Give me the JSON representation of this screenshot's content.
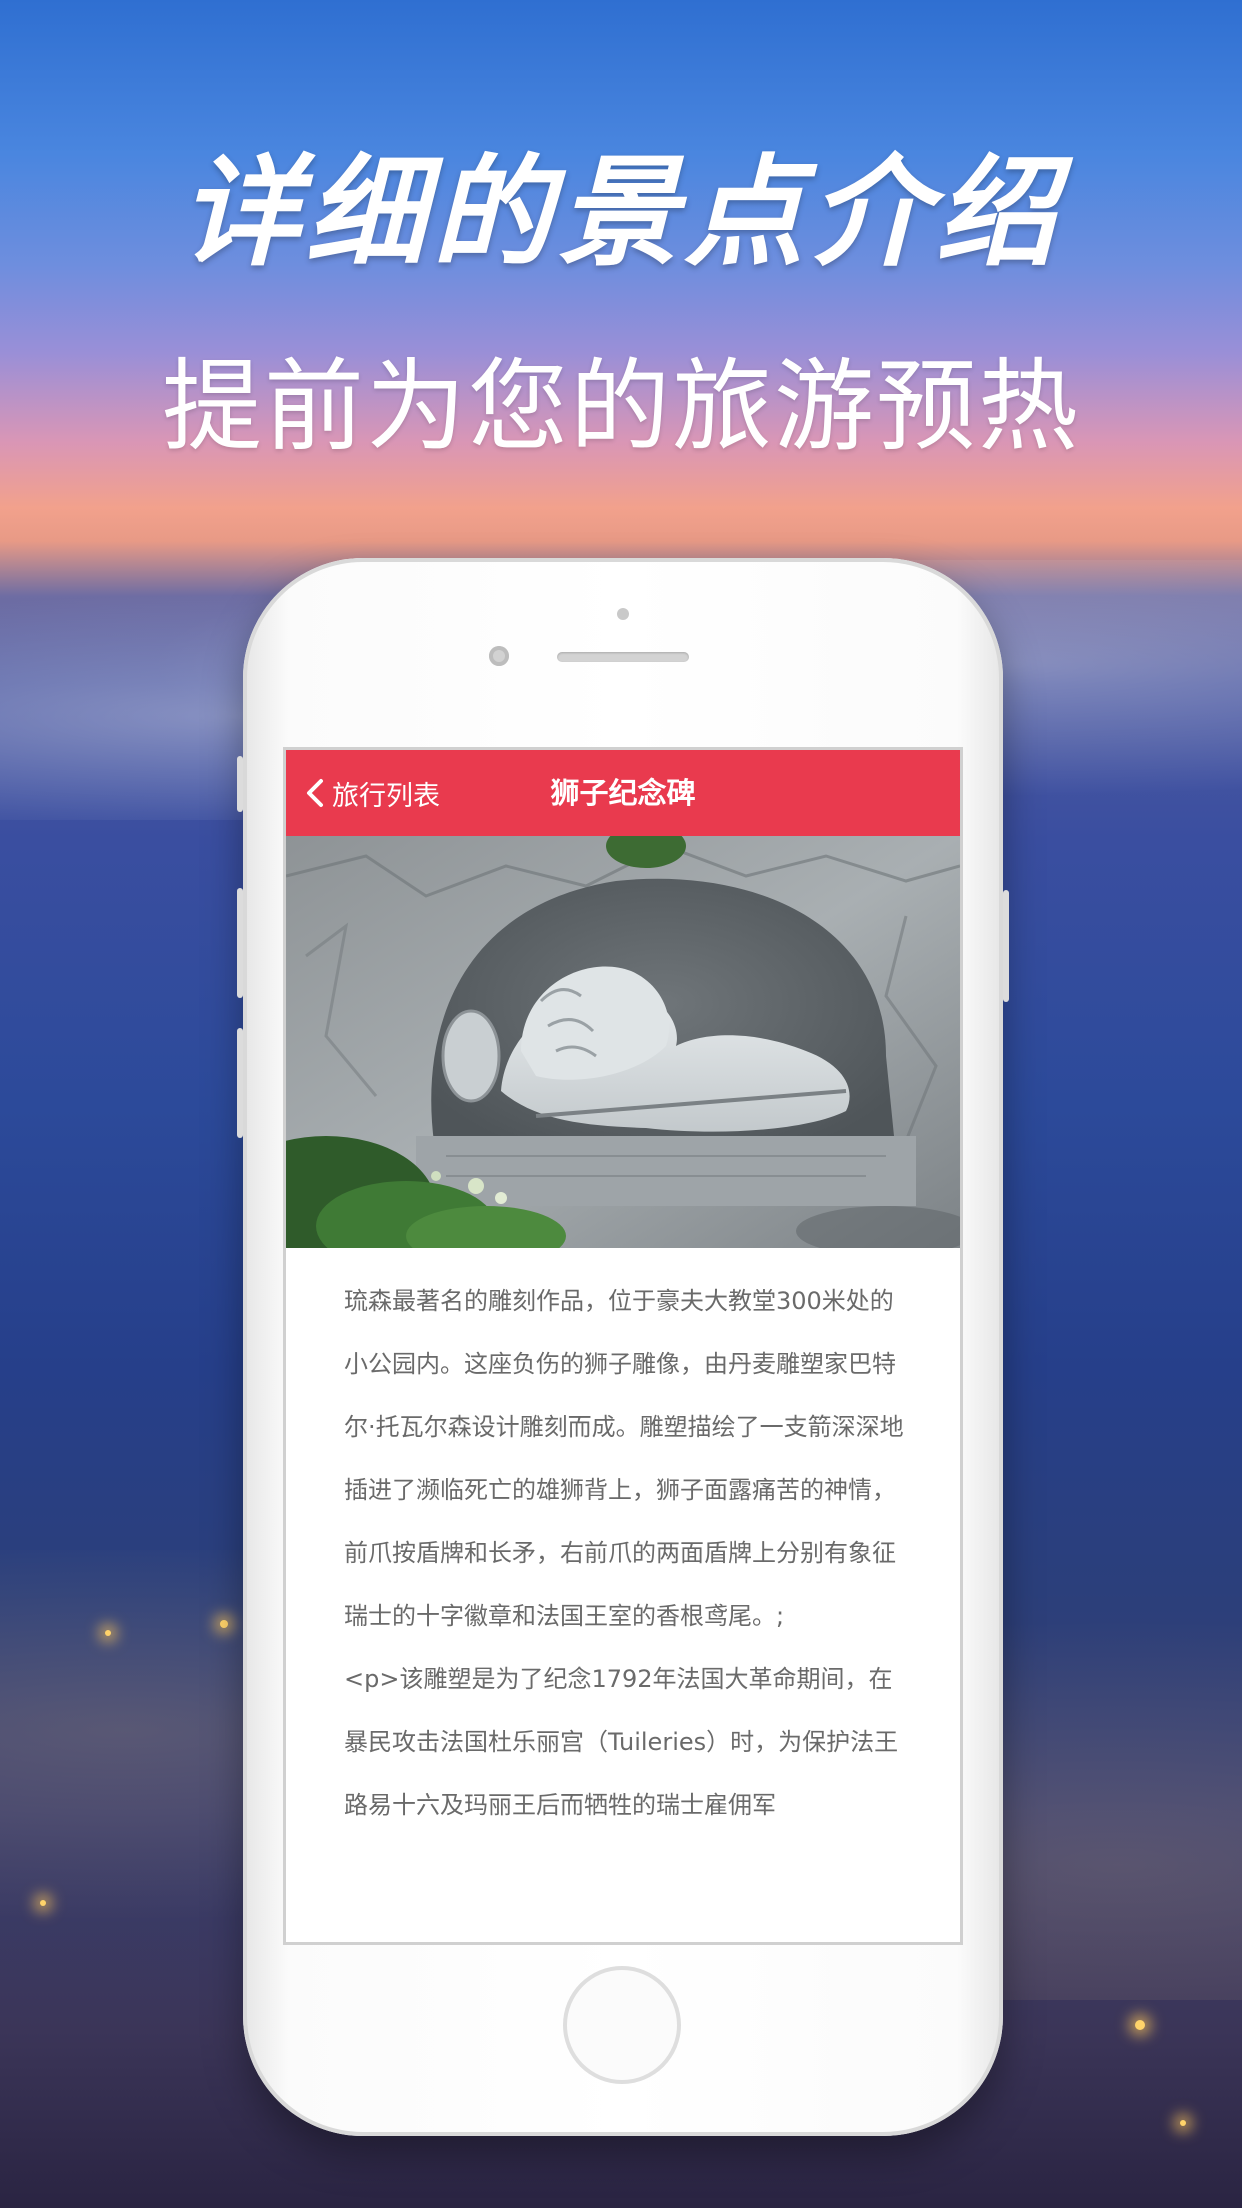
{
  "promo": {
    "headline": "详细的景点介绍",
    "subheadline": "提前为您的旅游预热"
  },
  "app": {
    "nav": {
      "back_label": "旅行列表",
      "back_icon": "chevron-left-icon",
      "title": "狮子纪念碑"
    },
    "hero_image": {
      "subject": "lion-monument-carving"
    },
    "article": {
      "paragraph_1": "琉森最著名的雕刻作品，位于豪夫大教堂300米处的小公园内。这座负伤的狮子雕像，由丹麦雕塑家巴特尔·托瓦尔森设计雕刻而成。雕塑描绘了一支箭深深地插进了濒临死亡的雄狮背上，狮子面露痛苦的神情，前爪按盾牌和长矛，右前爪的两面盾牌上分别有象征瑞士的十字徽章和法国王室的香根鸢尾。;",
      "paragraph_2": "<p>该雕塑是为了纪念1792年法国大革命期间，在暴民攻击法国杜乐丽宫（Tuileries）时，为保护法王路易十六及玛丽王后而牺牲的瑞士雇佣军"
    }
  },
  "colors": {
    "nav_bar": "#e93a4e",
    "body_text": "#6a6a6a"
  }
}
